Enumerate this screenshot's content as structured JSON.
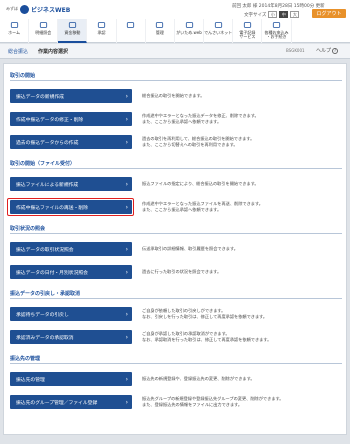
{
  "header": {
    "logo_small": "みずほ",
    "logo_text": "ビジネスWEB",
    "user_line": "前回  太郎 様  2014年8月28日 15時00分 更新",
    "user_name": "",
    "font_label": "文字サイズ",
    "font_sizes": [
      "小",
      "中",
      "大"
    ],
    "logout": "ログアウト"
  },
  "nav": [
    {
      "label": "ホーム",
      "icon": "home-icon"
    },
    {
      "label": "明細照会",
      "icon": "statement-icon"
    },
    {
      "label": "資金移動",
      "icon": "transfer-icon"
    },
    {
      "label": "承認",
      "icon": "approve-icon"
    },
    {
      "label": "",
      "icon": "blank-icon"
    },
    {
      "label": "管理",
      "icon": "admin-icon"
    },
    {
      "label": "がいため.web",
      "icon": "forex-icon"
    },
    {
      "label": "でんさいネット",
      "icon": "densai-icon"
    },
    {
      "label": "電子記録\nサービス",
      "icon": "record-icon"
    },
    {
      "label": "各種お申込み\n・お手続き",
      "icon": "application-icon"
    }
  ],
  "breadcrumb": {
    "main": "総合振込",
    "sub": "作業内容選択"
  },
  "screen_id": "BSGK001",
  "help": "ヘルプ",
  "sections": [
    {
      "title": "取引の開始",
      "items": [
        {
          "label": "振込データの新規作成",
          "desc": "総合振込の取引を開始できます。"
        },
        {
          "label": "作成中振込データの修正・削除",
          "desc": "作成途中やエラーとなった振込データを修正、削除できます。\nまた、ここから振込承認へ依頼できます。"
        },
        {
          "label": "過去の振込データからの作成",
          "desc": "過去の取引を再利用して、総合振込の取引を開始できます。\nまた、ここから切替えへの取引を再利用できます。"
        }
      ]
    },
    {
      "title": "取引の開始（ファイル受付）",
      "items": [
        {
          "label": "振込ファイルによる新規作成",
          "desc": "振込ファイルの指定により、総合振込の取引を開始できます。"
        },
        {
          "label": "作成中振込ファイルの再送・削除",
          "desc": "作成途中やエラーとなった振込ファイルを再送、削除できます。\nまた、ここから振込承認へ依頼できます。",
          "highlight": true
        }
      ]
    },
    {
      "title": "取引状況の照会",
      "items": [
        {
          "label": "振込データの取引状況照会",
          "desc": "伝送承取引の詳細情報、取引履歴を照会できます。"
        },
        {
          "label": "振込データの日付・月別状況照会",
          "desc": "過去に行った取引の状況を照会できます。"
        }
      ]
    },
    {
      "title": "振込データの引戻し・承認取消",
      "items": [
        {
          "label": "承認待ちデータの引戻し",
          "desc": "ご自身が依頼した取引の引戻しができます。\nなお、引戻しを行った取引は、修正して再度承認を依頼できます。"
        },
        {
          "label": "承認済みデータの承認取消",
          "desc": "ご自身が承認した取引の承認取消ができます。\nなお、承認取消を行った取引は、修正して再度承認を依頼できます。"
        }
      ]
    },
    {
      "title": "振込先の管理",
      "items": [
        {
          "label": "振込先の管理",
          "desc": "振込先の新規登録や、登録振込先の変更、削除ができます。"
        },
        {
          "label": "振込先のグループ管理／ファイル登録",
          "desc": "振込先グループの新規登録や登録振込先グループの変更、削除ができます。\nまた、登録振込先の情報をファイルに出力できます。"
        }
      ]
    }
  ],
  "colors": {
    "button": "#1f4f92",
    "accent": "#1a4e9c",
    "logout": "#e8912a",
    "highlight": "#e02020"
  }
}
